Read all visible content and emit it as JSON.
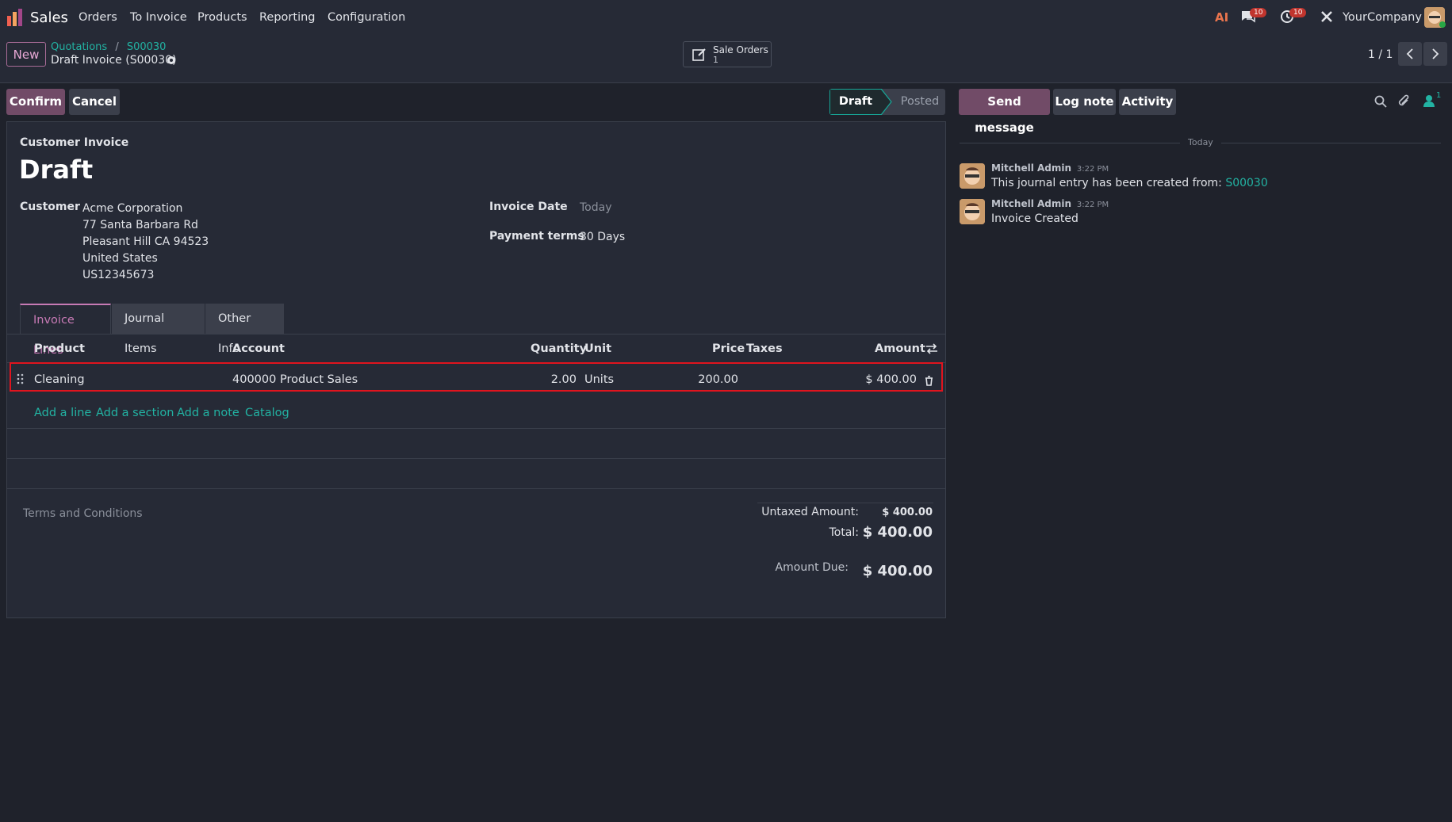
{
  "nav": {
    "app_name": "Sales",
    "items": [
      "Orders",
      "To Invoice",
      "Products",
      "Reporting",
      "Configuration"
    ],
    "messages_count": "10",
    "activities_count": "10",
    "company": "YourCompany"
  },
  "control_panel": {
    "new_label": "New",
    "breadcrumb": [
      "Quotations",
      "S00030"
    ],
    "record_title": "Draft Invoice (S00030)",
    "smart_button": {
      "label": "Sale Orders",
      "count": "1"
    },
    "pager": "1 / 1"
  },
  "actions": {
    "confirm_label": "Confirm",
    "cancel_label": "Cancel",
    "statusbar": [
      "Draft",
      "Posted"
    ]
  },
  "invoice": {
    "type_label": "Customer Invoice",
    "state": "Draft",
    "customer_label": "Customer",
    "customer_lines": [
      "Acme Corporation",
      "77 Santa Barbara Rd",
      "Pleasant Hill CA 94523",
      "United States",
      "US12345673"
    ],
    "invoice_date_label": "Invoice Date",
    "invoice_date_placeholder": "Today",
    "payment_terms_label": "Payment terms",
    "payment_terms_value": "30 Days"
  },
  "tabs": [
    "Invoice Lines",
    "Journal Items",
    "Other Info"
  ],
  "lines_table": {
    "headers": {
      "product": "Product",
      "account": "Account",
      "quantity": "Quantity",
      "unit": "Unit",
      "price": "Price",
      "taxes": "Taxes",
      "amount": "Amount"
    },
    "rows": [
      {
        "product": "Cleaning",
        "account": "400000 Product Sales",
        "quantity": "2.00",
        "unit": "Units",
        "price": "200.00",
        "taxes": "",
        "amount": "$ 400.00"
      }
    ],
    "add_links": [
      "Add a line",
      "Add a section",
      "Add a note",
      "Catalog"
    ]
  },
  "footer": {
    "terms_placeholder": "Terms and Conditions",
    "untaxed_label": "Untaxed Amount:",
    "untaxed_value": "$ 400.00",
    "total_label": "Total:",
    "total_value": "$ 400.00",
    "due_label": "Amount Due:",
    "due_value": "$ 400.00"
  },
  "chatter": {
    "send_message": "Send message",
    "log_note": "Log note",
    "activity": "Activity",
    "followers_count": "1",
    "date_separator": "Today",
    "messages": [
      {
        "author": "Mitchell Admin",
        "time": "3:22 PM",
        "body": "This journal entry has been created from: ",
        "link": "S00030"
      },
      {
        "author": "Mitchell Admin",
        "time": "3:22 PM",
        "body": "Invoice Created",
        "link": ""
      }
    ]
  },
  "colors": {
    "primary": "#714b67",
    "link": "#22b3a3",
    "highlight": "#e0141e"
  }
}
